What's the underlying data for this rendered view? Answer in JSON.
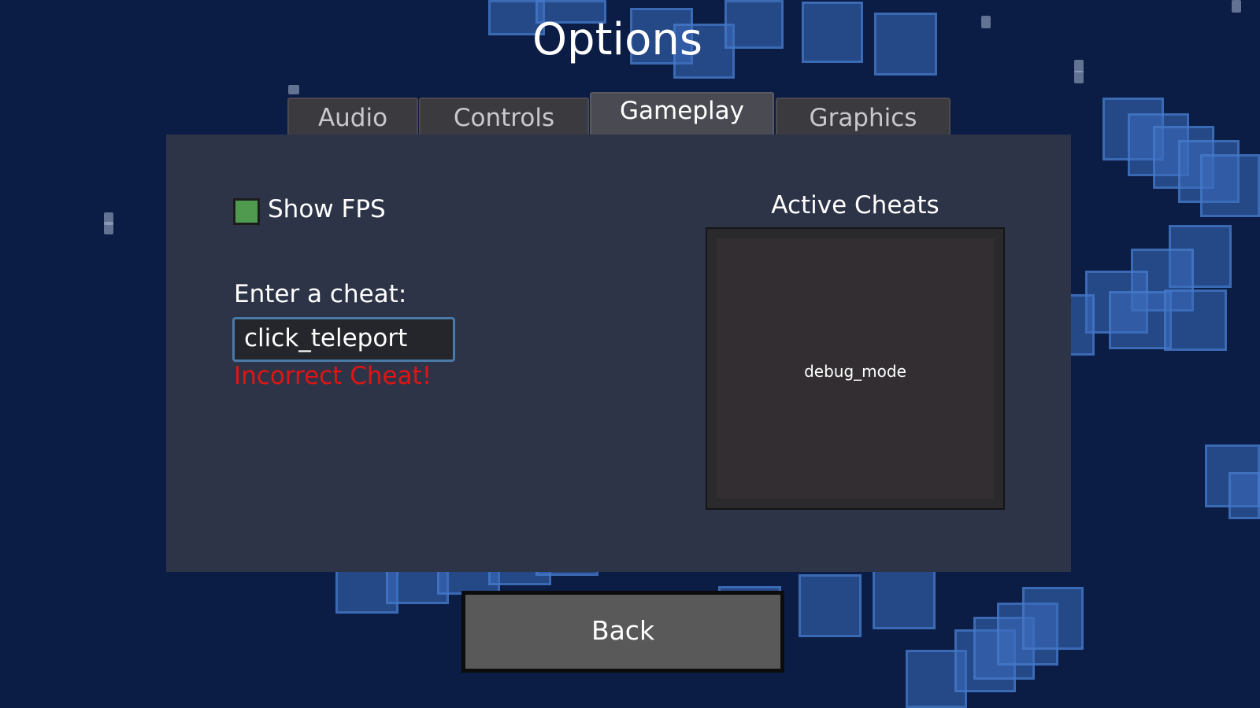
{
  "header": {
    "title": "Options"
  },
  "tabs": [
    {
      "label": "Audio",
      "active": false
    },
    {
      "label": "Controls",
      "active": false
    },
    {
      "label": "Gameplay",
      "active": true
    },
    {
      "label": "Graphics",
      "active": false
    }
  ],
  "gameplay": {
    "show_fps": {
      "label": "Show FPS",
      "checked": true
    },
    "cheat_entry": {
      "label": "Enter a cheat:",
      "value": "click_teleport",
      "error": "Incorrect Cheat!"
    },
    "active_cheats": {
      "title": "Active Cheats",
      "items": [
        "debug_mode"
      ]
    }
  },
  "footer": {
    "back_label": "Back"
  },
  "colors": {
    "background": "#0b1c45",
    "panel": "#2d3447",
    "checkbox_on": "#4f9a4f",
    "error": "#e01414",
    "button": "#595959"
  }
}
